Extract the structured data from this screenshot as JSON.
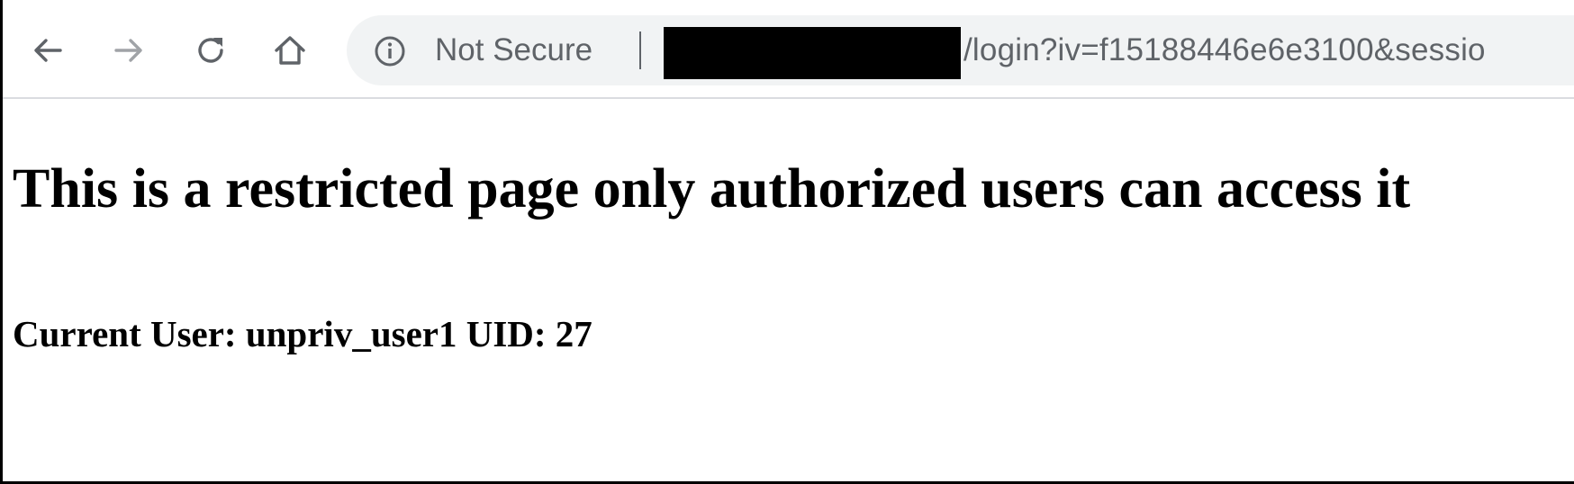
{
  "browser": {
    "toolbar": {
      "back_icon": "arrow-left-icon",
      "forward_icon": "arrow-right-icon",
      "reload_icon": "reload-icon",
      "home_icon": "home-icon"
    },
    "omnibox": {
      "info_icon": "info-circle-icon",
      "security_label": "Not Secure",
      "url_visible": "/login?iv=f15188446e6e3100&sessio",
      "host_redacted": true
    }
  },
  "page": {
    "heading": "This is a restricted page only authorized users can access it",
    "current_user_line": "Current User: unpriv_user1 UID: 27"
  },
  "colors": {
    "icon_active": "#5f6368",
    "icon_disabled": "#a0a3a7",
    "omnibox_bg": "#f1f3f4",
    "page_text": "#000000",
    "redaction": "#000000"
  }
}
